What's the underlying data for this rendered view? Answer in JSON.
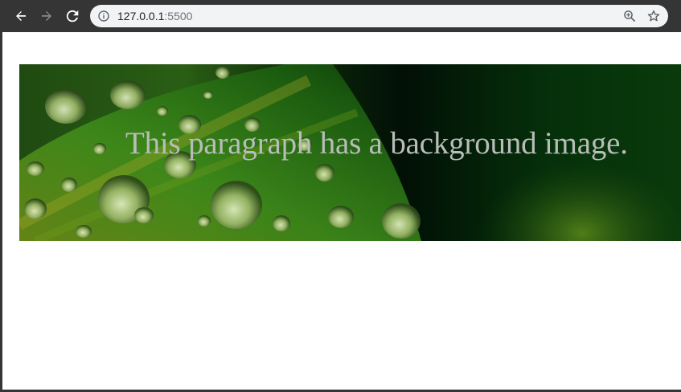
{
  "browser": {
    "url_host": "127.0.0.1",
    "url_port": ":5500",
    "icons": {
      "back": "arrow-left-icon",
      "forward": "arrow-right-icon",
      "reload": "reload-icon",
      "site_info": "info-icon",
      "zoom": "zoom-in-icon",
      "bookmark": "star-icon"
    }
  },
  "page": {
    "paragraph_text": "This paragraph has a background image.",
    "colors": {
      "text": "#b8bdb8",
      "banner_dark": "#031203",
      "banner_green": "#2f7a12"
    }
  }
}
